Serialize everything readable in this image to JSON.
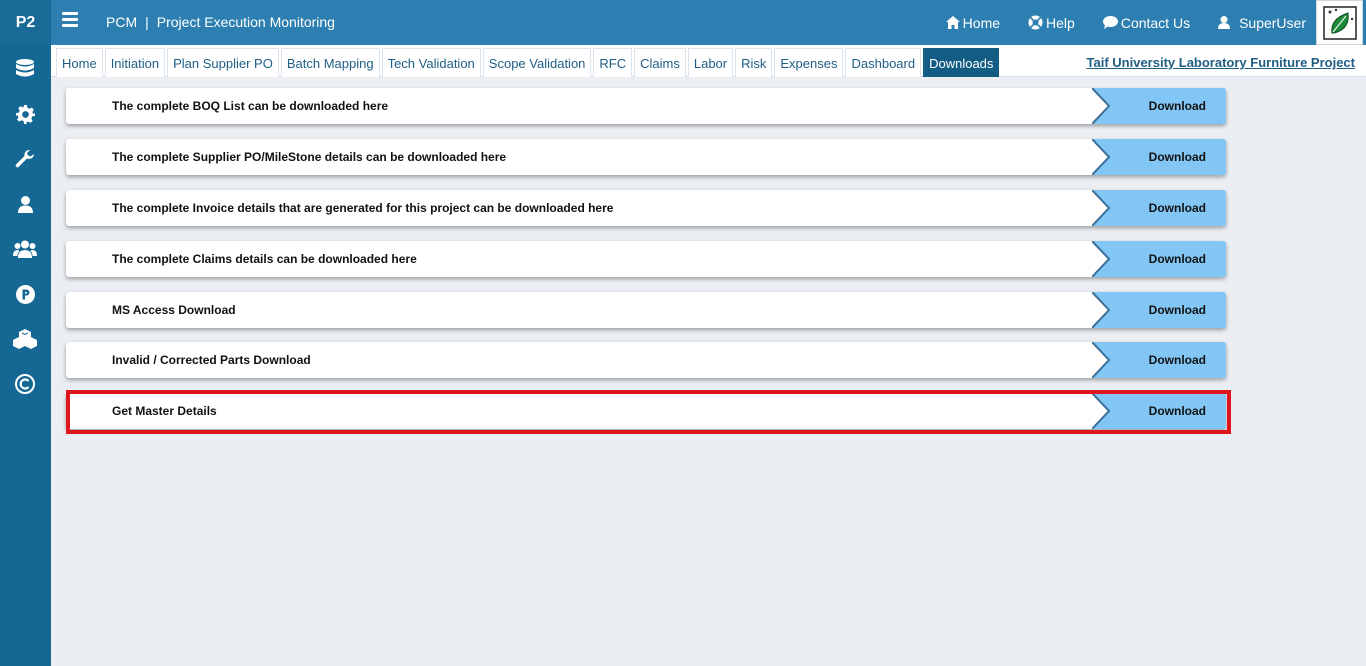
{
  "header": {
    "brand": "P2",
    "app_name": "PCM",
    "separator": "|",
    "app_subtitle": "Project Execution Monitoring",
    "nav": [
      {
        "label": "Home",
        "icon": "home-icon"
      },
      {
        "label": "Help",
        "icon": "lifebuoy-icon"
      },
      {
        "label": "Contact Us",
        "icon": "chat-icon"
      },
      {
        "label": "SuperUser",
        "icon": "user-icon"
      }
    ]
  },
  "sidebar": {
    "items": [
      "database-icon",
      "gear-icon",
      "wrench-icon",
      "user-icon",
      "users-icon",
      "parking-icon",
      "cubes-icon",
      "copyright-icon"
    ]
  },
  "tabs": [
    "Home",
    "Initiation",
    "Plan Supplier PO",
    "Batch Mapping",
    "Tech Validation",
    "Scope Validation",
    "RFC",
    "Claims",
    "Labor",
    "Risk",
    "Expenses",
    "Dashboard",
    "Downloads"
  ],
  "active_tab": "Downloads",
  "project_link": "Taif University Laboratory Furniture Project",
  "downloads": [
    {
      "label": "The complete BOQ List can be downloaded here",
      "button": "Download"
    },
    {
      "label": "The complete Supplier PO/MileStone details can be downloaded here",
      "button": "Download"
    },
    {
      "label": "The complete Invoice details that are generated for this project can be downloaded here",
      "button": "Download"
    },
    {
      "label": "The complete Claims details can be downloaded here",
      "button": "Download"
    },
    {
      "label": "MS Access Download",
      "button": "Download"
    },
    {
      "label": "Invalid / Corrected Parts Download",
      "button": "Download"
    },
    {
      "label": "Get Master Details",
      "button": "Download"
    }
  ],
  "highlighted_row": "Get Master Details",
  "colors": {
    "header": "#2c7fb0",
    "sidebar": "#166894",
    "active_tab": "#135c83",
    "download_button": "#82c6f5",
    "highlight": "#e0161f"
  }
}
